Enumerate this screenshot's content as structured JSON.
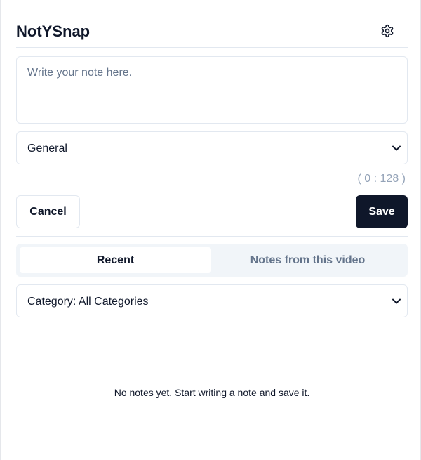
{
  "app": {
    "title": "NotYSnap"
  },
  "header": {
    "settings_icon": "gear-icon"
  },
  "note": {
    "placeholder": "Write your note here.",
    "value": ""
  },
  "category_select": {
    "selected": "General"
  },
  "counter": "( 0 : 128 )",
  "buttons": {
    "cancel_label": "Cancel",
    "save_label": "Save"
  },
  "tabs": [
    {
      "label": "Recent",
      "active": true
    },
    {
      "label": "Notes from this video",
      "active": false
    }
  ],
  "filter_select": {
    "selected": "Category: All Categories"
  },
  "empty_state": "No notes yet. Start writing a note and save it.",
  "colors": {
    "primary": "#0f172a",
    "muted": "#64748b",
    "border": "#e2e8f0",
    "tab_bg": "#f1f5f9"
  }
}
